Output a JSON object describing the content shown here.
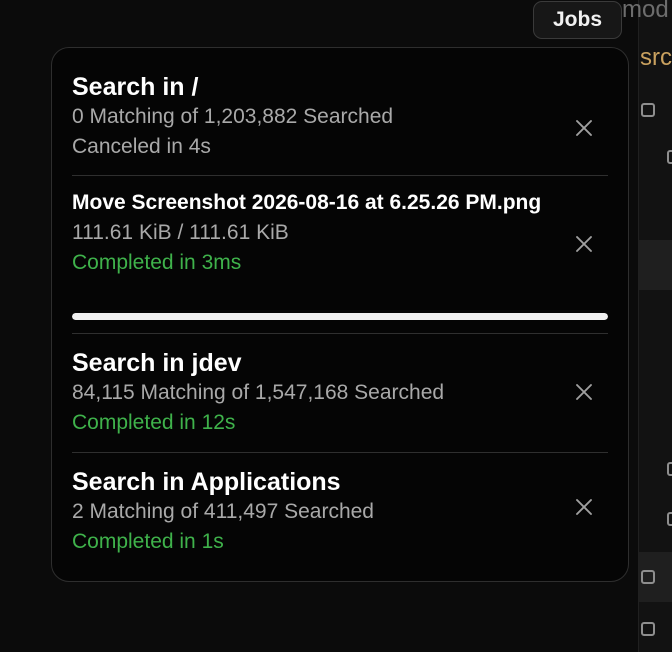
{
  "header": {
    "jobs_label": "Jobs"
  },
  "background": {
    "partial_text_top": "mod",
    "partial_text_folder": "src",
    "folder_color": "#c9a15f"
  },
  "jobs": [
    {
      "title": "Search in /",
      "detail": "0 Matching of 1,203,882 Searched",
      "status": "Canceled in 4s",
      "state": "canceled"
    },
    {
      "title": "Move Screenshot 2026-08-16 at 6.25.26 PM.png",
      "detail": "111.61 KiB / 111.61 KiB",
      "status": "Completed in 3ms",
      "state": "completed",
      "progress": 1.0
    },
    {
      "title": "Search in jdev",
      "detail": "84,115 Matching of 1,547,168 Searched",
      "status": "Completed in 12s",
      "state": "completed"
    },
    {
      "title": "Search in Applications",
      "detail": "2 Matching of 411,497 Searched",
      "status": "Completed in 1s",
      "state": "completed"
    }
  ],
  "icons": {
    "close": "close-icon"
  },
  "colors": {
    "completed": "#3fb24b",
    "canceled": "#a9a9a9",
    "panel_bg": "#050505"
  }
}
